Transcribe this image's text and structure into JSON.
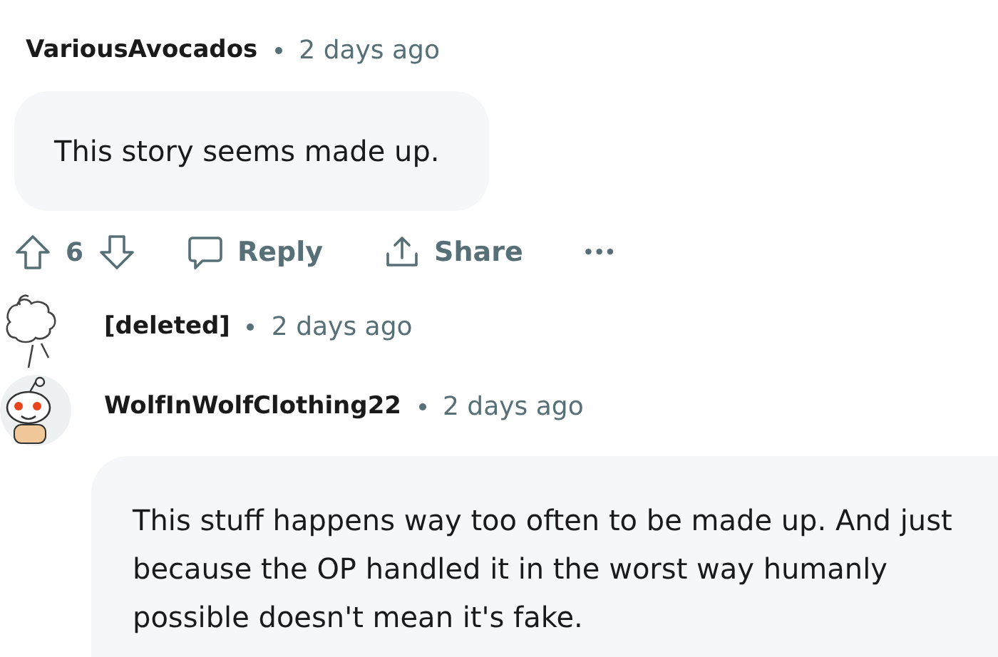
{
  "comments": [
    {
      "author": "VariousAvocados",
      "time": "2 days ago",
      "body": "This story seems made up.",
      "votes": "6",
      "actions": [
        {
          "kind": "reply",
          "label": "Reply"
        },
        {
          "kind": "share",
          "label": "Share"
        },
        {
          "kind": "more",
          "label": "•••"
        }
      ]
    },
    {
      "author": "[deleted]",
      "time": "2 days ago",
      "kind": "deleted"
    },
    {
      "author": "WolfInWolfClothing22",
      "time": "2 days ago",
      "kind": "snoo",
      "body": "This stuff happens way too often to be made up. And just because the OP handled it in the worst way humanly possible doesn't mean it's fake."
    }
  ]
}
